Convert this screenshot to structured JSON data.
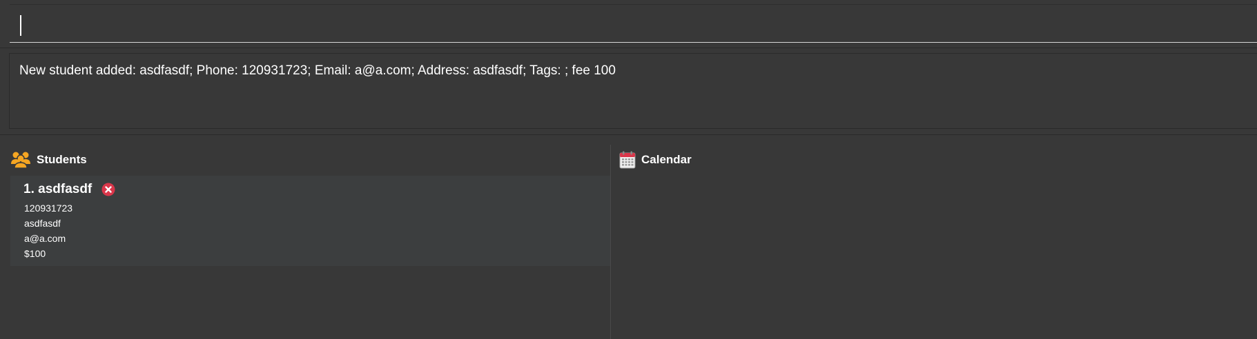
{
  "command": {
    "value": "",
    "placeholder": ""
  },
  "result": {
    "message": "New student added: asdfasdf; Phone: 120931723; Email: a@a.com; Address: asdfasdf; Tags: ; fee 100"
  },
  "students_panel": {
    "title": "Students",
    "icon": "people-icon",
    "items": [
      {
        "index_name": "1. asdfasdf",
        "phone": "120931723",
        "address": "asdfasdf",
        "email": "a@a.com",
        "fee": "$100",
        "status_icon": "remove-icon"
      }
    ]
  },
  "calendar_panel": {
    "title": "Calendar",
    "icon": "calendar-icon"
  },
  "colors": {
    "background": "#383838",
    "card": "#3c3e3f",
    "accent_orange": "#f5a623",
    "remove_red": "#d9364a"
  }
}
